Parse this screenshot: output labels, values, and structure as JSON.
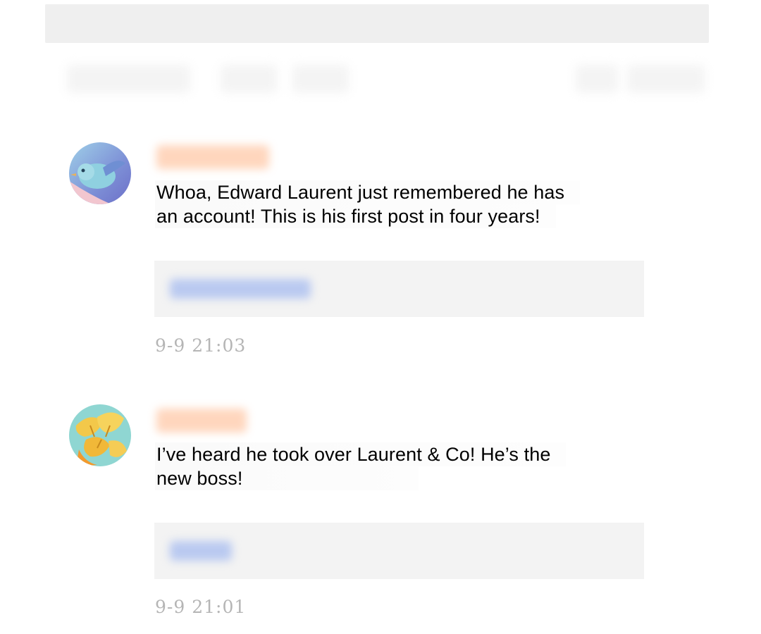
{
  "header": {},
  "comments": [
    {
      "avatar_icon": "bird-avatar-icon",
      "body_lines": [
        "Whoa, Edward Laurent just remembered he has",
        "an account! This is his first post in four years!"
      ],
      "timestamp": "9-9  21:03"
    },
    {
      "avatar_icon": "ginkgo-avatar-icon",
      "body_lines": [
        "I’ve heard he took over Laurent & Co! He’s the",
        "new boss!"
      ],
      "timestamp": "9-9  21:01"
    }
  ],
  "colors": {
    "username_blur": "#ffcfb2",
    "reply_link_blur": "#b9c9f0",
    "timestamp": "#b5b5b5",
    "reply_box_bg": "#f3f3f3"
  }
}
